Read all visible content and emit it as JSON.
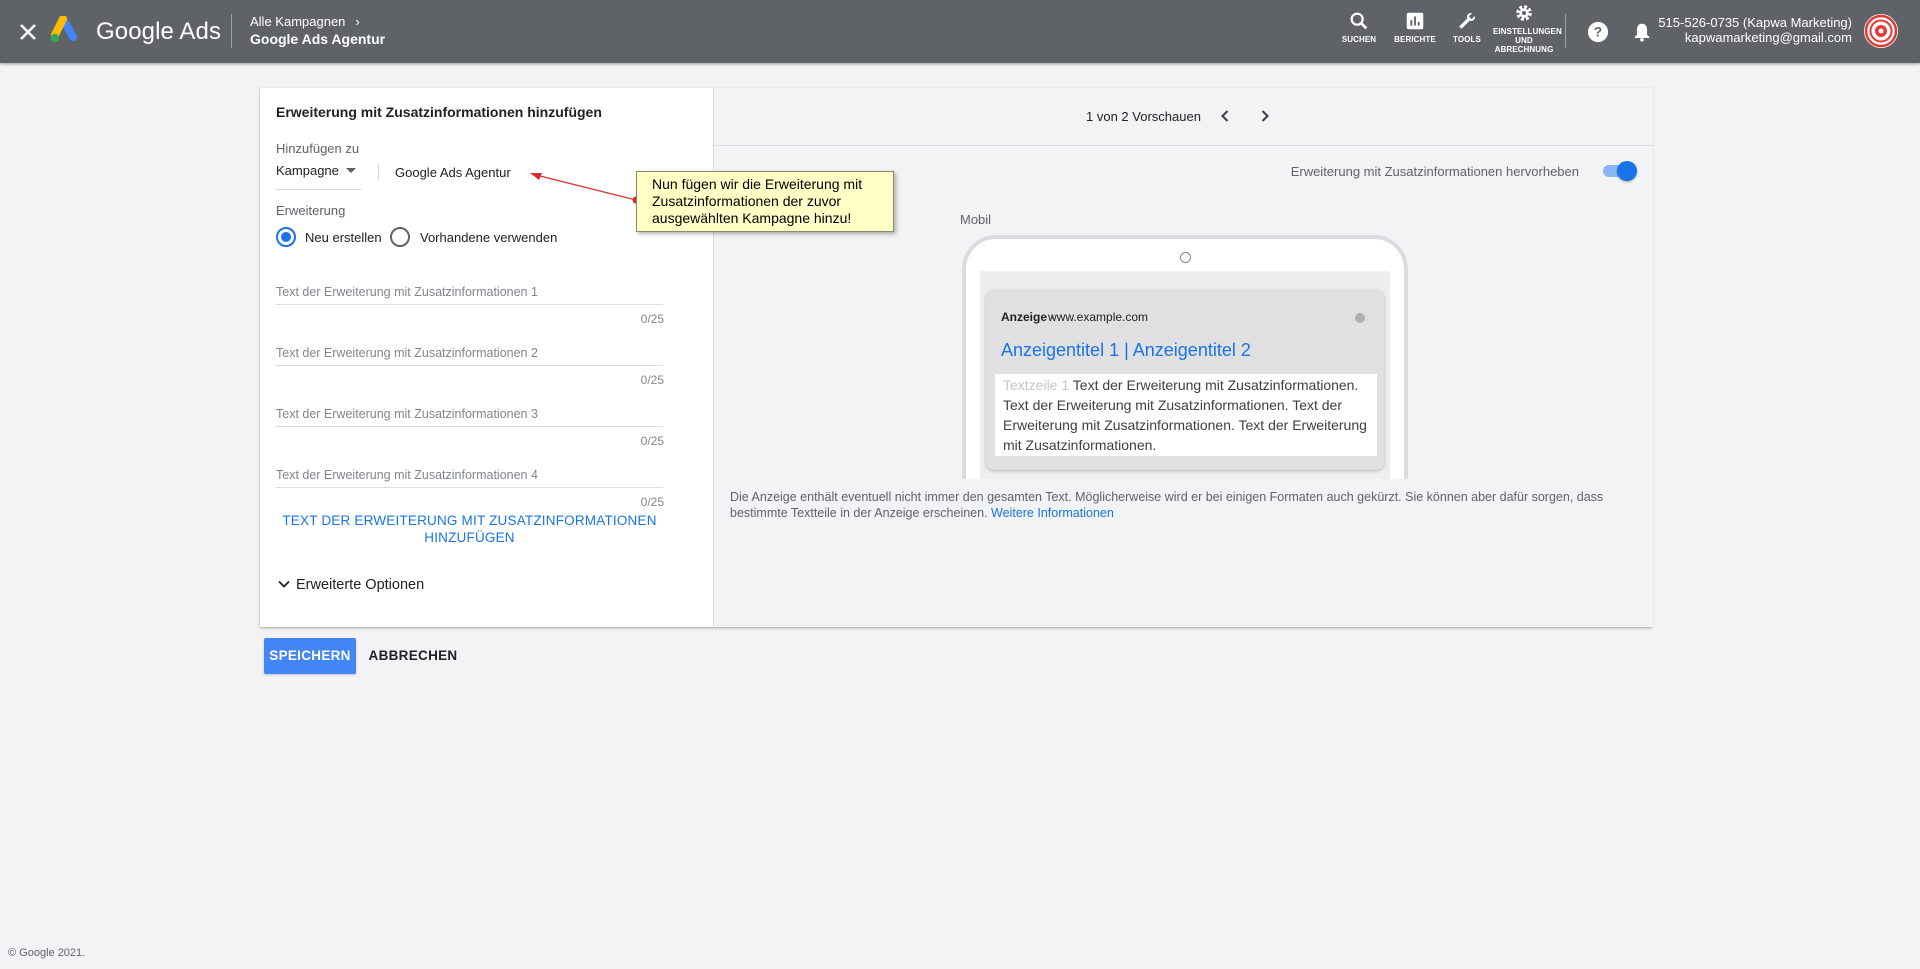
{
  "header": {
    "brand": "Google Ads",
    "breadcrumb_parent": "Alle Kampagnen",
    "breadcrumb_current": "Google Ads Agentur",
    "tools": [
      {
        "label": "SUCHEN",
        "icon": "search-icon"
      },
      {
        "label": "BERICHTE",
        "icon": "reports-icon"
      },
      {
        "label": "TOOLS",
        "icon": "wrench-icon"
      },
      {
        "label": "EINSTELLUNGEN UND ABRECHNUNG",
        "icon": "gear-icon"
      }
    ],
    "account_name": "515-526-0735 (Kapwa Marketing)",
    "account_email": "kapwamarketing@gmail.com"
  },
  "form": {
    "title": "Erweiterung mit Zusatzinformationen hinzufügen",
    "add_to_label": "Hinzufügen zu",
    "level_select": "Kampagne",
    "campaign_name": "Google Ads Agentur",
    "extension_label": "Erweiterung",
    "radio_new": "Neu erstellen",
    "radio_existing": "Vorhandene verwenden",
    "fields": [
      {
        "placeholder": "Text der Erweiterung mit Zusatzinformationen 1",
        "counter": "0/25"
      },
      {
        "placeholder": "Text der Erweiterung mit Zusatzinformationen 2",
        "counter": "0/25"
      },
      {
        "placeholder": "Text der Erweiterung mit Zusatzinformationen 3",
        "counter": "0/25"
      },
      {
        "placeholder": "Text der Erweiterung mit Zusatzinformationen 4",
        "counter": "0/25"
      }
    ],
    "add_text_link": "TEXT DER ERWEITERUNG MIT ZUSATZINFORMATIONEN HINZUFÜGEN",
    "advanced_options": "Erweiterte Optionen"
  },
  "preview": {
    "count_label": "1 von 2 Vorschauen",
    "highlight_label": "Erweiterung mit Zusatzinformationen hervorheben",
    "highlight_on": true,
    "device_label": "Mobil",
    "ad_tag": "Anzeige",
    "ad_url": "www.example.com",
    "ad_headline": "Anzeigentitel 1 | Anzeigentitel 2",
    "ad_body_faded": "Textzeile 1",
    "ad_body_text": "Text der Erweiterung mit Zusatzinformationen. Text der Erweiterung mit Zusatzinformationen. Text der Erweiterung mit Zusatzinformationen. Text der Erweiterung mit Zusatzinformationen.",
    "disclaimer": "Die Anzeige enthält eventuell nicht immer den gesamten Text. Möglicherweise wird er bei einigen Formaten auch gekürzt. Sie können aber dafür sorgen, dass bestimmte Textteile in der Anzeige erscheinen.",
    "more_info_link": "Weitere Informationen"
  },
  "annotation": {
    "text": "Nun fügen wir die Erweiterung mit Zusatzinformationen der zuvor ausgewählten Kampagne hinzu!"
  },
  "actions": {
    "save": "SPEICHERN",
    "cancel": "ABBRECHEN"
  },
  "footer": {
    "copyright": "© Google 2021."
  },
  "colors": {
    "topbar": "#5f6368",
    "accent": "#1a73e8",
    "save_button": "#4285f4",
    "callout_bg": "#ffffc6"
  }
}
